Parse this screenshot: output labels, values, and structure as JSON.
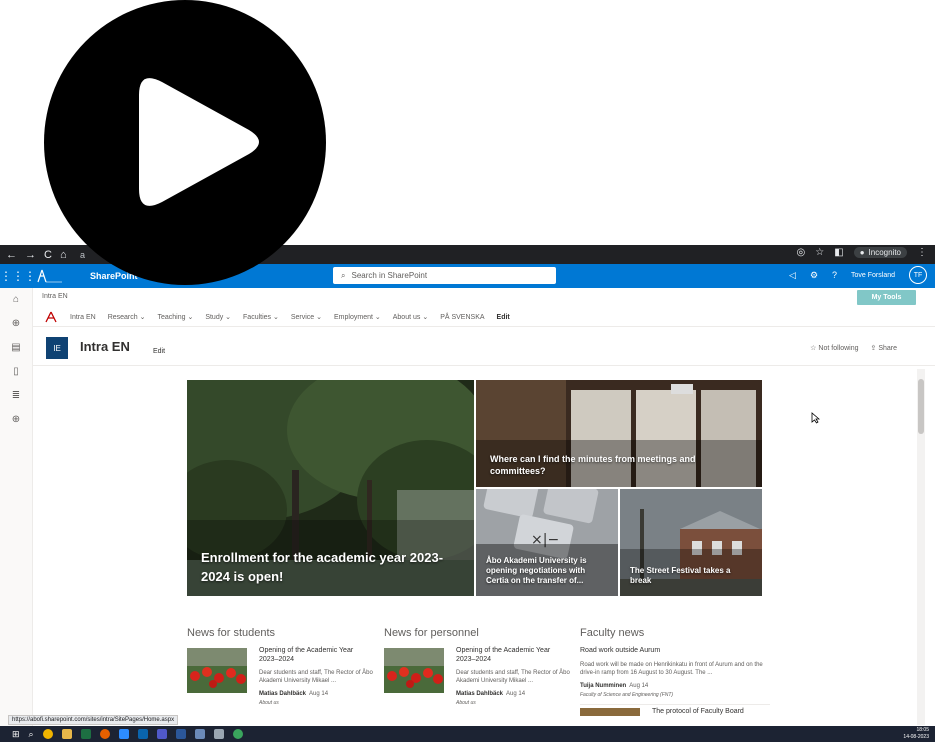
{
  "browser": {
    "address": "a",
    "incognito_label": "Incognito"
  },
  "suitebar": {
    "app_name": "SharePoint",
    "search_placeholder": "Search in SharePoint",
    "user_name": "Tove Forsland",
    "user_initials": "TF"
  },
  "site": {
    "breadcrumb": "Intra EN",
    "my_tools": "My Tools",
    "nav": [
      "Intra EN",
      "Research",
      "Teaching",
      "Study",
      "Faculties",
      "Service",
      "Employment",
      "About us",
      "PÅ SVENSKA",
      "Edit"
    ],
    "icon_initials": "IE",
    "title": "Intra EN",
    "edit": "Edit",
    "not_following": "Not following",
    "share": "Share"
  },
  "hero": {
    "main": "Enrollment for the academic year 2023-2024 is open!",
    "top_right": "Where can I find the minutes from meetings and committees?",
    "bottom_left": "Åbo Akademi University is opening negotiations with Certia on the transfer of...",
    "bottom_right": "The Street Festival takes a break"
  },
  "news": {
    "students": {
      "heading": "News for students",
      "title": "Opening of the Academic Year 2023–2024",
      "body": "Dear students and staff, The Rector of Åbo Akademi University Mikael ...",
      "author": "Matias Dahlbäck",
      "date": "Aug 14",
      "tag": "About us"
    },
    "personnel": {
      "heading": "News for personnel",
      "title": "Opening of the Academic Year 2023–2024",
      "body": "Dear students and staff, The Rector of Åbo Akademi University Mikael ...",
      "author": "Matias Dahlbäck",
      "date": "Aug 14",
      "tag": "About us"
    },
    "faculty": {
      "heading": "Faculty news",
      "title": "Road work outside Aurum",
      "body": "Road work will be made on Henrikinkatu in front of Aurum and on the drive-in ramp from 16 August to 30 August. The ...",
      "author": "Tuija Numminen",
      "date": "Aug 14",
      "tag": "Faculty of Science and Engineering (FNT)",
      "next_title": "The protocol of Faculty Board"
    }
  },
  "status_url": "https://abofi.sharepoint.com/sites/intra/SitePages/Home.aspx",
  "clock": {
    "time": "18:05",
    "date": "14-08-2023"
  },
  "colors": {
    "suitebar": "#0078d4",
    "mytools": "#81c7c7",
    "site_icon": "#0f4273"
  }
}
